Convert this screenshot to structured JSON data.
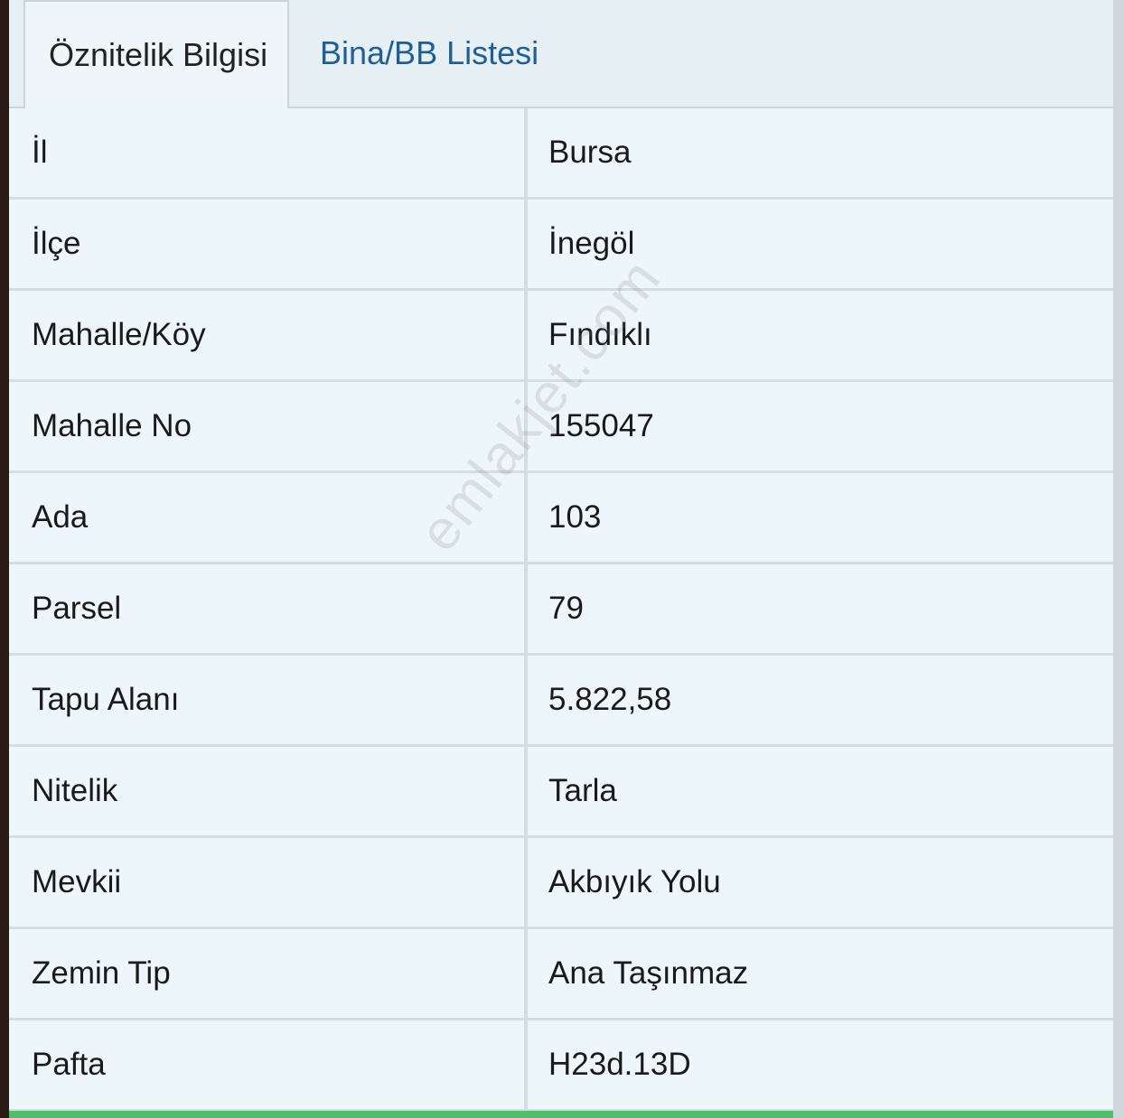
{
  "tabs": [
    {
      "label": "Öznitelik Bilgisi",
      "active": true
    },
    {
      "label": "Bina/BB Listesi",
      "active": false
    }
  ],
  "rows": [
    {
      "key": "İl",
      "value": "Bursa"
    },
    {
      "key": "İlçe",
      "value": "İnegöl"
    },
    {
      "key": "Mahalle/Köy",
      "value": "Fındıklı"
    },
    {
      "key": "Mahalle No",
      "value": "155047"
    },
    {
      "key": "Ada",
      "value": "103"
    },
    {
      "key": "Parsel",
      "value": "79"
    },
    {
      "key": "Tapu Alanı",
      "value": "5.822,58"
    },
    {
      "key": "Nitelik",
      "value": "Tarla"
    },
    {
      "key": "Mevkii",
      "value": "Akbıyık Yolu"
    },
    {
      "key": "Zemin Tip",
      "value": "Ana Taşınmaz"
    },
    {
      "key": "Pafta",
      "value": "H23d.13D"
    }
  ],
  "watermark": "emlakjet.com",
  "colors": {
    "tab_active_text": "#222222",
    "tab_inactive_text": "#1f5f93",
    "bottom_accent": "#4fbf6b"
  }
}
